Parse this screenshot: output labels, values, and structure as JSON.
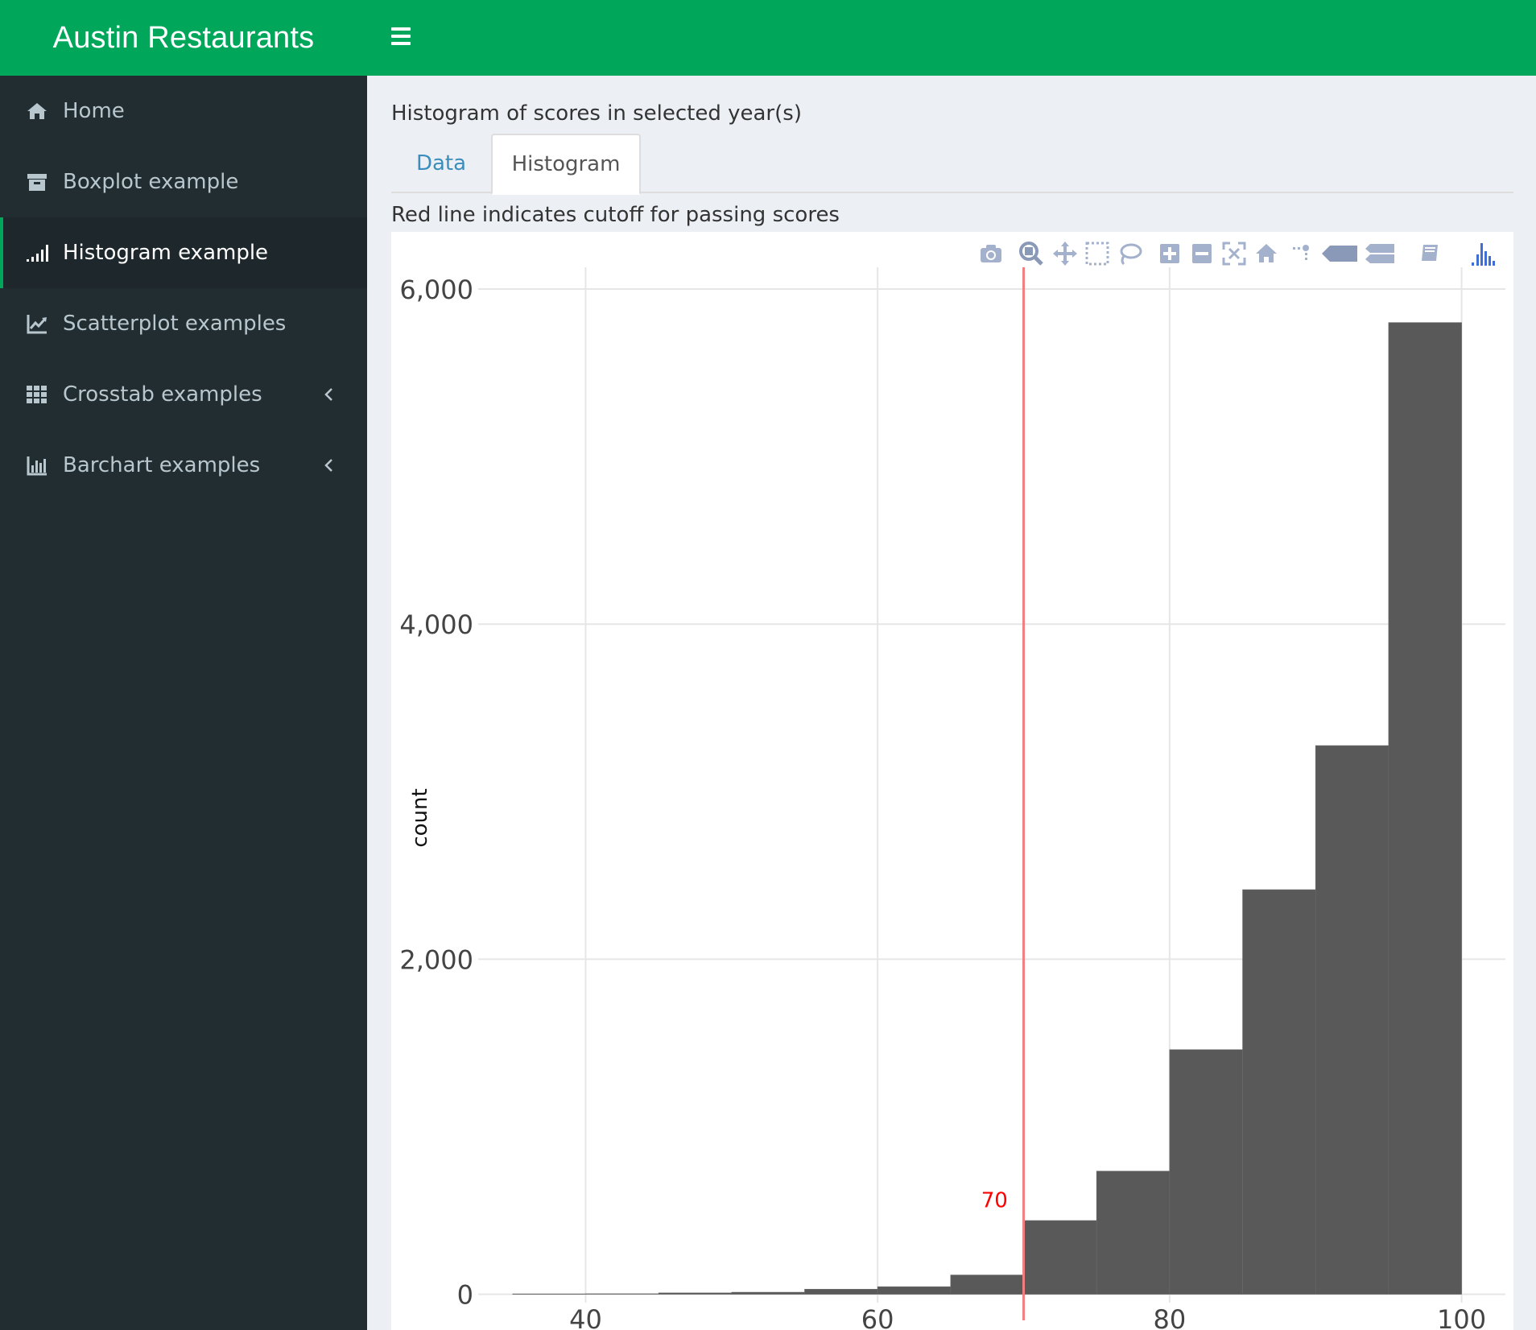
{
  "app": {
    "title": "Austin Restaurants"
  },
  "sidebar": {
    "items": [
      {
        "label": "Home",
        "icon": "home-icon"
      },
      {
        "label": "Boxplot example",
        "icon": "archive-icon"
      },
      {
        "label": "Histogram example",
        "icon": "signal-icon",
        "active": true
      },
      {
        "label": "Scatterplot examples",
        "icon": "line-chart-icon"
      },
      {
        "label": "Crosstab examples",
        "icon": "grid-icon",
        "expandable": true
      },
      {
        "label": "Barchart examples",
        "icon": "bar-chart-icon",
        "expandable": true
      }
    ]
  },
  "main": {
    "box_title": "Histogram of scores in selected year(s)",
    "tabs": [
      {
        "label": "Data"
      },
      {
        "label": "Histogram",
        "active": true
      }
    ],
    "note": "Red line indicates cutoff for passing scores"
  },
  "modebar": {
    "buttons": [
      "camera-icon",
      "zoom-icon",
      "pan-icon",
      "box-select-icon",
      "lasso-icon",
      "zoom-in-icon",
      "zoom-out-icon",
      "autoscale-icon",
      "reset-axes-icon",
      "spike-lines-icon",
      "hover-closest-icon",
      "hover-compare-icon",
      "edit-icon",
      "plotly-logo-icon"
    ]
  },
  "chart_data": {
    "type": "bar",
    "title": "",
    "xlabel": "",
    "ylabel": "count",
    "xlim": [
      32.2,
      103
    ],
    "ylim": [
      -50,
      6130
    ],
    "x_ticks": [
      40,
      60,
      80,
      100
    ],
    "x_tick_labels": [
      "40",
      "60",
      "80",
      "100"
    ],
    "y_ticks": [
      0,
      2000,
      4000,
      6000
    ],
    "y_tick_labels": [
      "0",
      "2,000",
      "4,000",
      "6,000"
    ],
    "grid": true,
    "bin_width": 5,
    "bins": [
      {
        "x0": 35,
        "x1": 40,
        "count": 2
      },
      {
        "x0": 40,
        "x1": 45,
        "count": 3
      },
      {
        "x0": 45,
        "x1": 50,
        "count": 8
      },
      {
        "x0": 50,
        "x1": 55,
        "count": 12
      },
      {
        "x0": 55,
        "x1": 60,
        "count": 30
      },
      {
        "x0": 60,
        "x1": 65,
        "count": 45
      },
      {
        "x0": 65,
        "x1": 70,
        "count": 115
      },
      {
        "x0": 70,
        "x1": 75,
        "count": 440
      },
      {
        "x0": 75,
        "x1": 80,
        "count": 735
      },
      {
        "x0": 80,
        "x1": 85,
        "count": 1460
      },
      {
        "x0": 85,
        "x1": 90,
        "count": 2415
      },
      {
        "x0": 90,
        "x1": 95,
        "count": 3275
      },
      {
        "x0": 95,
        "x1": 100,
        "count": 5800
      }
    ],
    "bar_color": "#595959",
    "cutoff_line": {
      "x": 70,
      "color": "#f08080"
    },
    "annotations": [
      {
        "text": "70",
        "x": 68,
        "y": 520,
        "color": "#ff0000"
      }
    ]
  }
}
